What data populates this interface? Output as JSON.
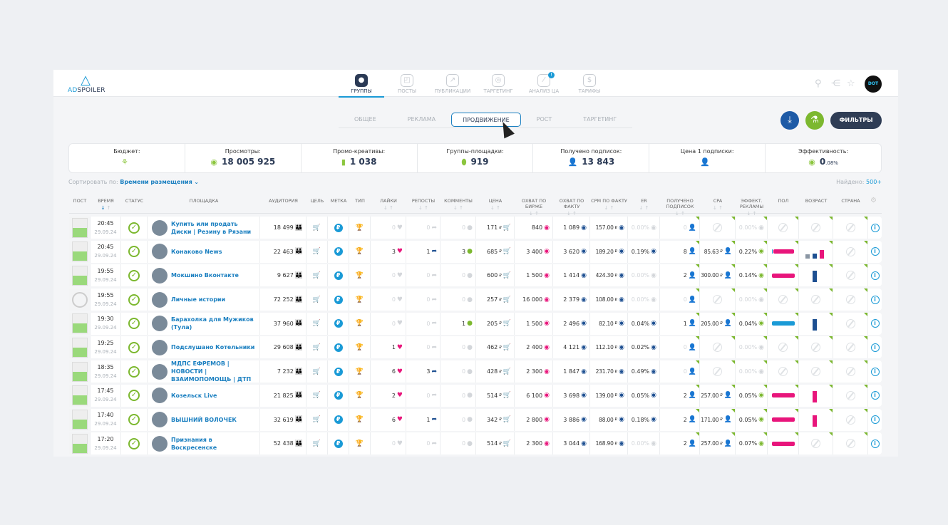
{
  "header": {
    "logo_prefix": "AD",
    "logo_suffix": "SPOILER",
    "nav": [
      {
        "label": "ГРУППЫ",
        "icon": "groups-icon",
        "active": true
      },
      {
        "label": "ПОСТЫ",
        "icon": "megaphone-icon"
      },
      {
        "label": "ПУБЛИКАЦИИ",
        "icon": "share-icon"
      },
      {
        "label": "ТАРГЕТИНГ",
        "icon": "target-icon"
      },
      {
        "label": "АНАЛИЗ ЦА",
        "icon": "magic-wand-icon",
        "badge": "!"
      },
      {
        "label": "ТАРИФЫ",
        "icon": "price-tag-icon"
      }
    ],
    "avatar_text": "DOT"
  },
  "subtabs": [
    {
      "label": "ОБЩЕЕ"
    },
    {
      "label": "РЕКЛАМА"
    },
    {
      "label": "ПРОДВИЖЕНИЕ",
      "active": true
    },
    {
      "label": "РОСТ"
    },
    {
      "label": "ТАРГЕТИНГ"
    }
  ],
  "actions": {
    "filters_label": "ФИЛЬТРЫ",
    "download_color": "#1d5aa6",
    "lab_color": "#7cb82f"
  },
  "stats": [
    {
      "label": "Бюджет:",
      "value": "",
      "icon": "budget-icon"
    },
    {
      "label": "Просмотры:",
      "value": "18 005 925",
      "icon": "eye-icon"
    },
    {
      "label": "Промо-креативы:",
      "value": "1 038",
      "icon": "file-icon"
    },
    {
      "label": "Группы-площадки:",
      "value": "919",
      "icon": "pin-icon"
    },
    {
      "label": "Получено подписок:",
      "value": "13 843",
      "icon": "user-plus-icon"
    },
    {
      "label": "Цена 1 подписки:",
      "value": "",
      "icon": "user-icon"
    },
    {
      "label": "Эффективность:",
      "value": "0",
      "value_small": ".08%",
      "icon": "eye-icon"
    }
  ],
  "sort": {
    "label": "Сортировать по:",
    "value": "Времени размещения"
  },
  "found": {
    "label": "Найдено:",
    "value": "500+"
  },
  "columns": [
    "ПОСТ",
    "ВРЕМЯ",
    "СТАТУС",
    "ПЛОЩАДКА",
    "АУДИТОРИЯ",
    "ЦЕЛЬ",
    "МЕТКА",
    "ТИП",
    "ЛАЙКИ",
    "РЕПОСТЫ",
    "КОММЕНТЫ",
    "ЦЕНА",
    "ОХВАТ ПО БИРЖЕ",
    "ОХВАТ ПО ФАКТУ",
    "CPM ПО ФАКТУ",
    "ER",
    "ПОЛУЧЕНО ПОДПИСОК",
    "CPA",
    "ЭФФЕКТ. РЕКЛАМЫ",
    "ПОЛ",
    "ВОЗРАСТ",
    "СТРАНА"
  ],
  "currency": "₽",
  "rows": [
    {
      "time": "20:45",
      "date": "29.09.24",
      "name": "Купить или продать Диски | Резину в Рязани",
      "audience": "18 499",
      "likes": "0",
      "reposts": "0",
      "comments": "0",
      "price": "171",
      "reach_exchange": "840",
      "reach_fact": "1 089",
      "cpm": "157.00",
      "er": "0.00%",
      "subs": "0",
      "cpa": null,
      "eff": "0.00%",
      "gender": null,
      "age": null
    },
    {
      "time": "20:45",
      "date": "29.09.24",
      "name": "Конаково News",
      "audience": "22 463",
      "likes": "3",
      "reposts": "1",
      "comments": "3",
      "price": "685",
      "reach_exchange": "3 400",
      "reach_fact": "3 620",
      "cpm": "189.20",
      "er": "0.19%",
      "subs": "8",
      "cpa": "85.63",
      "eff": "0.22%",
      "gender": {
        "male": 0.05,
        "female": 0.95
      },
      "age": [
        {
          "color": "#8a96a3",
          "level": 0.3
        },
        {
          "color": "#1d4f91",
          "level": 0.35
        },
        {
          "color": "#e8157b",
          "level": 0.6
        }
      ]
    },
    {
      "time": "19:55",
      "date": "29.09.24",
      "name": "Мокшино Вконтакте",
      "audience": "9 627",
      "likes": "0",
      "reposts": "0",
      "comments": "0",
      "price": "600",
      "reach_exchange": "1 500",
      "reach_fact": "1 414",
      "cpm": "424.30",
      "er": "0.00%",
      "subs": "2",
      "cpa": "300.00",
      "eff": "0.14%",
      "gender": {
        "male": 0,
        "female": 1
      },
      "age": [
        {
          "color": "#1d4f91",
          "level": 0.8
        }
      ]
    },
    {
      "time": "19:55",
      "date": "29.09.24",
      "name": "Личные истории",
      "audience": "72 252",
      "likes": "0",
      "reposts": "0",
      "comments": "0",
      "price": "257",
      "reach_exchange": "16 000",
      "reach_fact": "2 379",
      "cpm": "108.00",
      "er": "0.00%",
      "subs": "0",
      "cpa": null,
      "eff": "0.00%",
      "gender": null,
      "age": null,
      "no_post_image": true
    },
    {
      "time": "19:30",
      "date": "29.09.24",
      "name": "Барахолка для Мужиков (Тула)",
      "audience": "37 960",
      "likes": "0",
      "reposts": "0",
      "comments": "1",
      "price": "205",
      "reach_exchange": "1 500",
      "reach_fact": "2 496",
      "cpm": "82.10",
      "er": "0.04%",
      "subs": "1",
      "cpa": "205.00",
      "eff": "0.04%",
      "gender": {
        "male": 1,
        "female": 0
      },
      "age": [
        {
          "color": "#1d4f91",
          "level": 0.8
        }
      ]
    },
    {
      "time": "19:25",
      "date": "29.09.24",
      "name": "Подслушано Котельники",
      "audience": "29 608",
      "likes": "1",
      "reposts": "0",
      "comments": "0",
      "price": "462",
      "reach_exchange": "2 400",
      "reach_fact": "4 121",
      "cpm": "112.10",
      "er": "0.02%",
      "subs": "0",
      "cpa": null,
      "eff": "0.00%",
      "gender": null,
      "age": null
    },
    {
      "time": "18:35",
      "date": "29.09.24",
      "name": "МДПС ЕФРЕМОВ | НОВОСТИ | ВЗАИМОПОМОЩЬ | ДТП",
      "audience": "7 232",
      "likes": "6",
      "reposts": "3",
      "comments": "0",
      "price": "428",
      "reach_exchange": "2 300",
      "reach_fact": "1 847",
      "cpm": "231.70",
      "er": "0.49%",
      "subs": "0",
      "cpa": null,
      "eff": "0.00%",
      "gender": null,
      "age": null
    },
    {
      "time": "17:45",
      "date": "29.09.24",
      "name": "Козельск Live",
      "audience": "21 825",
      "likes": "2",
      "reposts": "0",
      "comments": "0",
      "price": "514",
      "reach_exchange": "6 100",
      "reach_fact": "3 698",
      "cpm": "139.00",
      "er": "0.05%",
      "subs": "2",
      "cpa": "257.00",
      "eff": "0.05%",
      "gender": {
        "male": 0,
        "female": 1
      },
      "age": [
        {
          "color": "#e8157b",
          "level": 0.8
        }
      ]
    },
    {
      "time": "17:40",
      "date": "29.09.24",
      "name": "ВЫШНИЙ ВОЛОЧЕК",
      "audience": "32 619",
      "likes": "6",
      "reposts": "1",
      "comments": "0",
      "price": "342",
      "reach_exchange": "2 800",
      "reach_fact": "3 886",
      "cpm": "88.00",
      "er": "0.18%",
      "subs": "2",
      "cpa": "171.00",
      "eff": "0.05%",
      "gender": {
        "male": 0,
        "female": 1
      },
      "age": [
        {
          "color": "#e8157b",
          "level": 0.8
        }
      ]
    },
    {
      "time": "17:20",
      "date": "29.09.24",
      "name": "Признания в Воскресенске",
      "audience": "52 438",
      "likes": "0",
      "reposts": "0",
      "comments": "0",
      "price": "514",
      "reach_exchange": "2 300",
      "reach_fact": "3 044",
      "cpm": "168.90",
      "er": "0.00%",
      "subs": "2",
      "cpa": "257.00",
      "eff": "0.07%",
      "gender": {
        "male": 0,
        "female": 1
      },
      "age": null
    }
  ]
}
